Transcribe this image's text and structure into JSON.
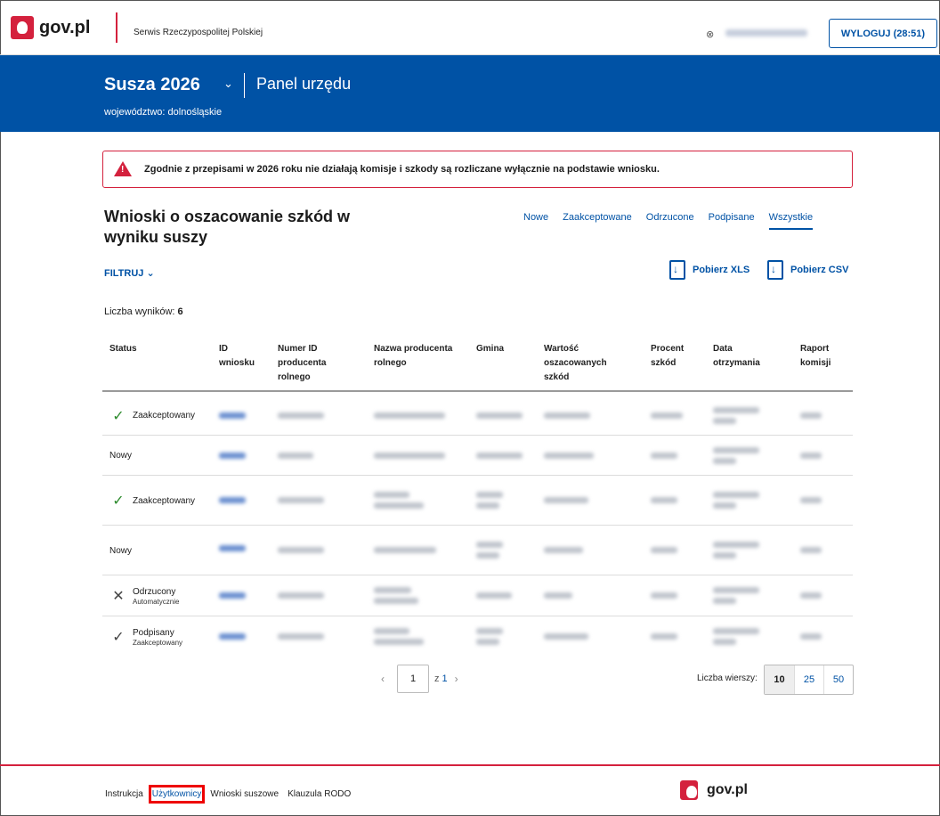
{
  "header": {
    "logo_text": "gov.pl",
    "service_name": "Serwis Rzeczypospolitej Polskiej",
    "user_icon": "user-icon",
    "logout_label": "WYLOGUJ (28:51)"
  },
  "hero": {
    "title": "Susza  2026",
    "panel": "Panel urzędu",
    "subtitle": "województwo: dolnośląskie"
  },
  "alert": {
    "text": "Zgodnie z przepisami w 2026 roku nie działają komisje i szkody są rozliczane wyłącznie na podstawie wniosku."
  },
  "main": {
    "heading": "Wnioski o oszacowanie szkód w wyniku suszy",
    "tabs": [
      "Nowe",
      "Zaakceptowane",
      "Odrzucone",
      "Podpisane",
      "Wszystkie"
    ],
    "active_tab": "Wszystkie",
    "filter_label": "FILTRUJ",
    "download_xls": "Pobierz XLS",
    "download_csv": "Pobierz CSV",
    "count_label": "Liczba wyników:",
    "count_value": "6"
  },
  "table": {
    "columns": [
      "Status",
      "ID\nwniosku",
      "Numer ID\nproducenta\nrolnego",
      "Nazwa producenta\nrolnego",
      "Gmina",
      "Wartość\noszacowanych\nszkód",
      "Procent\nszkód",
      "Data\notrzymania",
      "Raport\nkomisji"
    ],
    "rows": [
      {
        "status": "Zaakceptowany",
        "sub": "",
        "icon": "check-icon"
      },
      {
        "status": "Nowy",
        "sub": "",
        "icon": ""
      },
      {
        "status": "Zaakceptowany",
        "sub": "",
        "icon": "check-icon"
      },
      {
        "status": "Nowy",
        "sub": "",
        "icon": ""
      },
      {
        "status": "Odrzucony",
        "sub": "Automatycznie",
        "icon": "close-icon"
      },
      {
        "status": "Podpisany",
        "sub": "Zaakceptowany",
        "icon": "check-icon"
      }
    ]
  },
  "pagination": {
    "page": "1",
    "of_label": "z",
    "total": "1",
    "rows_label": "Liczba wierszy:",
    "rows_options": [
      "10",
      "25",
      "50"
    ],
    "rows_selected": "10"
  },
  "footer": {
    "links": [
      "Instrukcja",
      "Użytkownicy",
      "Wnioski suszowe",
      "Klauzula RODO"
    ],
    "highlighted_link": "Użytkownicy",
    "logo_text": "gov.pl"
  },
  "colors": {
    "brand_blue": "#0052a5",
    "brand_red": "#d4213d",
    "success_green": "#2d8b2d"
  }
}
